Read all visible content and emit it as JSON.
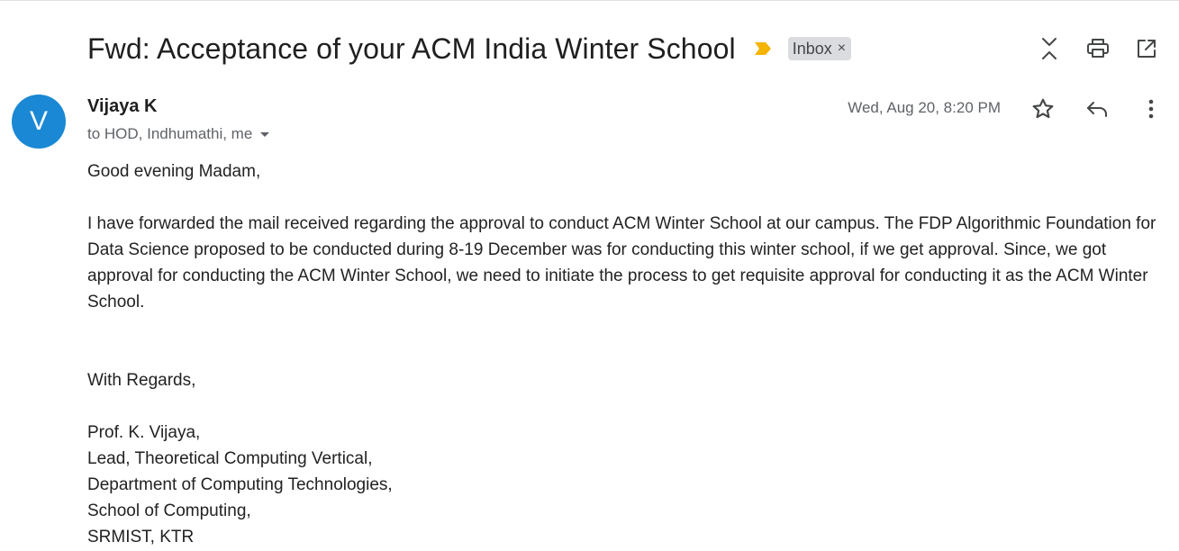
{
  "email": {
    "subject": "Fwd: Acceptance of your ACM India Winter School",
    "label": "Inbox",
    "label_close": "×",
    "sender_initial": "V",
    "sender_name": "Vijaya K",
    "recipients": "to HOD, Indhumathi, me",
    "date": "Wed, Aug 20, 8:20 PM",
    "greeting": "Good evening Madam,",
    "paragraph": "I have forwarded the mail received regarding the approval to conduct ACM Winter School at our campus. The FDP Algorithmic Foundation for Data Science proposed to be conducted during 8-19 December was for conducting this winter school, if we get approval. Since, we got approval for conducting the ACM Winter School, we need to initiate the process to get requisite approval for conducting it as the ACM Winter School.",
    "closing": "With Regards,",
    "signature": [
      "Prof. K. Vijaya,",
      "Lead, Theoretical Computing Vertical,",
      "Department of Computing Technologies,",
      "School of Computing,",
      "SRMIST, KTR"
    ]
  },
  "icons": {
    "importance": "importance-marker-icon",
    "collapse": "collapse-all-icon",
    "print": "print-icon",
    "open_new": "open-in-new-window-icon",
    "star": "star-icon",
    "reply": "reply-icon",
    "more": "more-vert-icon",
    "details": "caret-down-icon"
  },
  "colors": {
    "avatar": "#1a88d4",
    "importance": "#f4b400",
    "label_chip": "#dadce0"
  }
}
